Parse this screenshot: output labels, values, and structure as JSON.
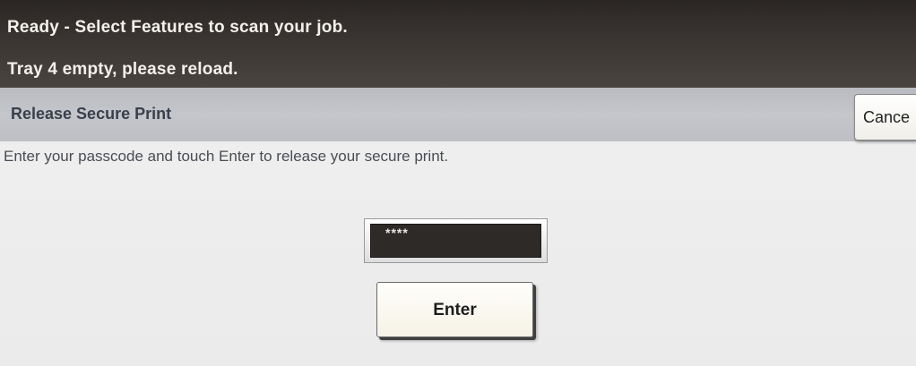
{
  "status": {
    "line1": "Ready -  Select Features to scan your job.",
    "line2": "Tray 4 empty, please reload."
  },
  "dialog": {
    "title": "Release Secure Print",
    "cancel_label": "Cance",
    "instruction": "Enter your passcode and touch Enter to release your secure print.",
    "passcode_value": "****",
    "enter_label": "Enter"
  }
}
